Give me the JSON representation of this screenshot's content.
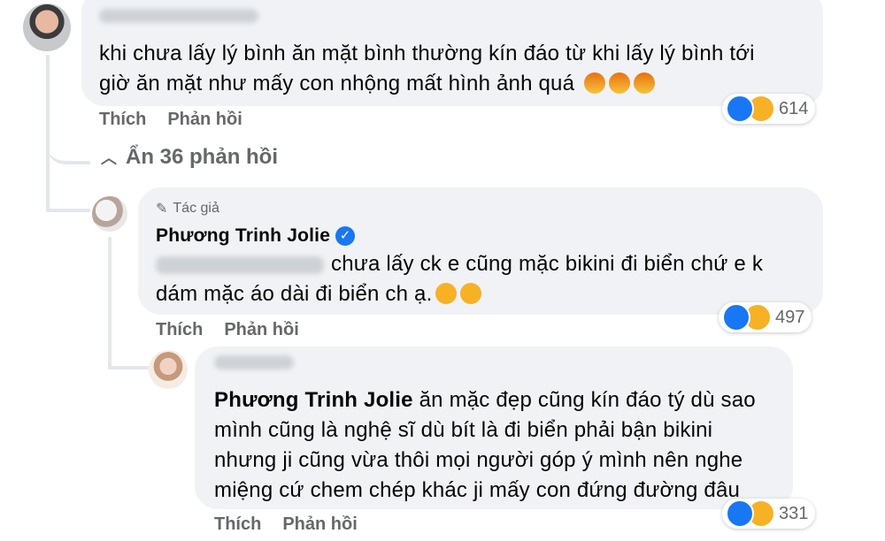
{
  "comment1": {
    "line1": "khi chưa lấy lý bình ăn mặt bình thường kín đáo từ khi lấy lý bình tới",
    "line2": "giờ ăn mặt như mấy con nhộng mất hình ảnh quá",
    "like_label": "Thích",
    "reply_label": "Phản hồi",
    "reaction_count": "614"
  },
  "hide_replies": "Ẩn 36 phản hồi",
  "comment2": {
    "author_tag": "Tác giả",
    "author_name": "Phương Trinh Jolie",
    "line1": "chưa lấy ck e cũng mặc bikini đi biển chứ e k",
    "line2": "dám mặc áo dài đi biển ch ạ.",
    "like_label": "Thích",
    "reply_label": "Phản hồi",
    "reaction_count": "497"
  },
  "comment3": {
    "mention": "Phương Trinh Jolie",
    "line1_rest": " ăn mặc đẹp cũng kín đáo tý dù sao",
    "line2": "mình cũng là nghệ sĩ dù bít là đi biển phải bận bikini",
    "line3": "nhưng ji cũng vừa thôi mọi người góp ý mình nên nghe",
    "line4": "miệng cứ chem chép khác ji mấy con đứng đường đâu",
    "like_label": "Thích",
    "reply_label": "Phản hồi",
    "reaction_count": "331"
  },
  "colors": {
    "bubble": "#f0f2f5",
    "meta_text": "#65676b",
    "like_blue": "#1877f2",
    "haha_yellow": "#f7b125"
  },
  "icons": [
    "pen-icon",
    "verified-badge-icon",
    "chevron-up-icon",
    "like-reaction-icon",
    "haha-reaction-icon",
    "angry-emoji-icon",
    "laughing-emoji-icon"
  ]
}
